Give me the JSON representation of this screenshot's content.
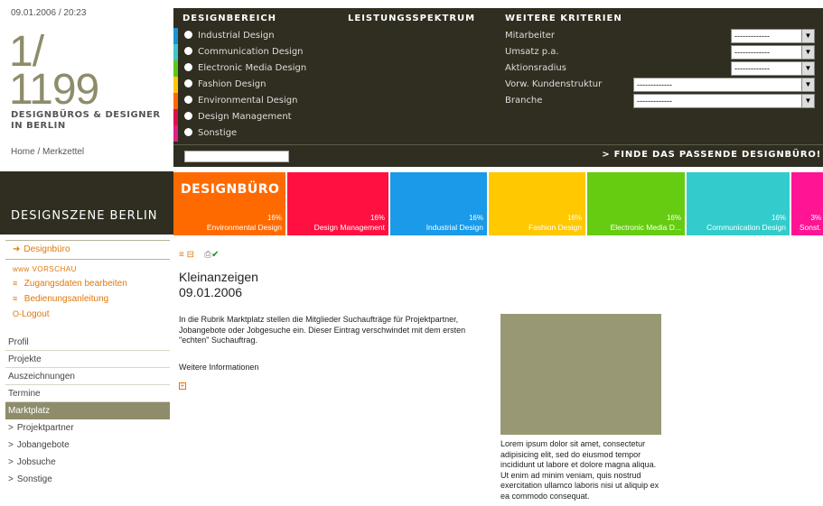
{
  "header": {
    "datetime": "09.01.2006 / 20:23",
    "counter_top": "1/",
    "counter_bottom": "1199",
    "counter_label": "DESIGNBÜROS & DESIGNER IN BERLIN",
    "breadcrumb_home": "Home",
    "breadcrumb_sep": " / ",
    "breadcrumb_current": "Merkzettel"
  },
  "scene_title": "DESIGNSZENE BERLIN",
  "filter": {
    "col1": "DESIGNBEREICH",
    "col2": "LEISTUNGSSPEKTRUM",
    "col3": "WEITERE KRITERIEN",
    "design_areas": [
      {
        "label": "Industrial Design",
        "color": "#1a94d4"
      },
      {
        "label": "Communication Design",
        "color": "#3dc8c8"
      },
      {
        "label": "Electronic Media Design",
        "color": "#5cc81a"
      },
      {
        "label": "Fashion Design",
        "color": "#ffc800"
      },
      {
        "label": "Environmental Design",
        "color": "#ff6a00"
      },
      {
        "label": "Design Management",
        "color": "#e0104a"
      },
      {
        "label": "Sonstige",
        "color": "#e0208a"
      }
    ],
    "criteria": [
      {
        "label": "Mitarbeiter",
        "value": "-------------"
      },
      {
        "label": "Umsatz p.a.",
        "value": "-------------"
      },
      {
        "label": "Aktionsradius",
        "value": "-------------"
      },
      {
        "label": "Vorw. Kundenstruktur",
        "value": "-------------"
      },
      {
        "label": "Branche",
        "value": "-------------"
      }
    ],
    "find_label": "> FINDE DAS PASSENDE DESIGNBÜRO!"
  },
  "tiles": {
    "heading": "DESIGNBÜRO",
    "items": [
      {
        "pct": "16%",
        "name": "Environmental Design",
        "color": "#ff6a00"
      },
      {
        "pct": "16%",
        "name": "Design Management",
        "color": "#ff1040"
      },
      {
        "pct": "16%",
        "name": "Industrial Design",
        "color": "#1a9ae8"
      },
      {
        "pct": "16%",
        "name": "Fashion Design",
        "color": "#ffc800"
      },
      {
        "pct": "16%",
        "name": "Electronic Media D...",
        "color": "#66cc11"
      },
      {
        "pct": "16%",
        "name": "Communication Design",
        "color": "#33cccc"
      },
      {
        "pct": "3%",
        "name": "Sonst.",
        "color": "#ff1493"
      }
    ]
  },
  "sidebar": {
    "top_item": "Designbüro",
    "preview": "www VORSCHAU",
    "links": [
      {
        "icon": "≡",
        "label": "Zugangsdaten bearbeiten"
      },
      {
        "icon": "≡",
        "label": "Bedienungsanleitung"
      },
      {
        "icon": "O-",
        "label": "Logout"
      }
    ],
    "menu": [
      "Profil",
      "Projekte",
      "Auszeichnungen",
      "Termine",
      "Marktplatz"
    ],
    "submenu": [
      "Projektpartner",
      "Jobangebote",
      "Jobsuche",
      "Sonstige"
    ]
  },
  "main": {
    "title": "Kleinanzeigen",
    "date": "09.01.2006",
    "body": "In die Rubrik Marktplatz stellen die Mitglieder Suchaufträge für Projektpartner, Jobangebote oder Jobgesuche ein. Dieser Eintrag verschwindet mit dem ersten \"echten\" Suchauftrag.",
    "more_label": "Weitere Informationen",
    "caption": "Lorem ipsum dolor sit amet, consectetur adipisicing elit, sed do eiusmod tempor incididunt ut labore et dolore magna aliqua. Ut enim ad minim veniam, quis nostrud exercitation ullamco laboris nisi ut aliquip ex ea commodo consequat."
  }
}
